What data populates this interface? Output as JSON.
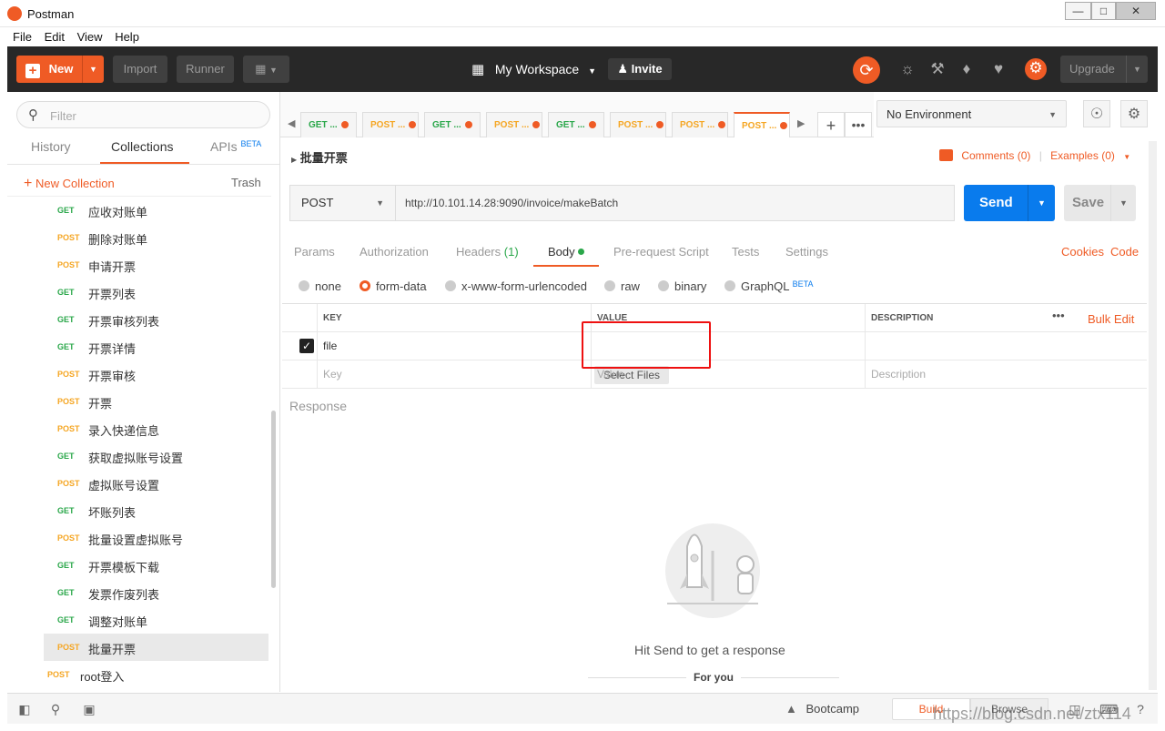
{
  "window": {
    "title": "Postman",
    "minimize": "—",
    "maximize": "□",
    "close": "✕"
  },
  "menu": [
    "File",
    "Edit",
    "View",
    "Help"
  ],
  "header": {
    "new_label": "New",
    "import_label": "Import",
    "runner_label": "Runner",
    "workspace_label": "My Workspace",
    "invite_label": "Invite",
    "upgrade_label": "Upgrade"
  },
  "sidebar": {
    "filter_placeholder": "Filter",
    "tabs": [
      "History",
      "Collections",
      "APIs"
    ],
    "apis_badge": "BETA",
    "new_collection_label": "New Collection",
    "trash_label": "Trash",
    "requests": [
      {
        "method": "GET",
        "name": "应收对账单"
      },
      {
        "method": "POST",
        "name": "删除对账单"
      },
      {
        "method": "POST",
        "name": "申请开票"
      },
      {
        "method": "GET",
        "name": "开票列表"
      },
      {
        "method": "GET",
        "name": "开票审核列表"
      },
      {
        "method": "GET",
        "name": "开票详情"
      },
      {
        "method": "POST",
        "name": "开票审核"
      },
      {
        "method": "POST",
        "name": "开票"
      },
      {
        "method": "POST",
        "name": "录入快递信息"
      },
      {
        "method": "GET",
        "name": "获取虚拟账号设置"
      },
      {
        "method": "POST",
        "name": "虚拟账号设置"
      },
      {
        "method": "GET",
        "name": "坏账列表"
      },
      {
        "method": "POST",
        "name": "批量设置虚拟账号"
      },
      {
        "method": "GET",
        "name": "开票模板下载"
      },
      {
        "method": "GET",
        "name": "发票作废列表"
      },
      {
        "method": "GET",
        "name": "调整对账单"
      },
      {
        "method": "POST",
        "name": "批量开票"
      }
    ],
    "extra_request": {
      "method": "POST",
      "name": "root登入"
    }
  },
  "tabs": [
    {
      "method": "GET",
      "label": "GET ..."
    },
    {
      "method": "POST",
      "label": "POST ..."
    },
    {
      "method": "GET",
      "label": "GET ..."
    },
    {
      "method": "POST",
      "label": "POST ..."
    },
    {
      "method": "GET",
      "label": "GET ..."
    },
    {
      "method": "POST",
      "label": "POST ..."
    },
    {
      "method": "POST",
      "label": "POST ..."
    },
    {
      "method": "POST",
      "label": "POST ..."
    }
  ],
  "environment": {
    "selected": "No Environment"
  },
  "request": {
    "name": "批量开票",
    "comments": "Comments (0)",
    "examples": "Examples (0)",
    "method": "POST",
    "url": "http://10.101.14.28:9090/invoice/makeBatch",
    "send_label": "Send",
    "save_label": "Save"
  },
  "request_tabs": {
    "items": [
      "Params",
      "Authorization",
      "Headers",
      "Body",
      "Pre-request Script",
      "Tests",
      "Settings"
    ],
    "headers_count": "(1)",
    "cookies": "Cookies",
    "code": "Code"
  },
  "body_options": [
    "none",
    "form-data",
    "x-www-form-urlencoded",
    "raw",
    "binary",
    "GraphQL"
  ],
  "graphql_badge": "BETA",
  "kv_table": {
    "headers": [
      "KEY",
      "VALUE",
      "DESCRIPTION"
    ],
    "bulk_edit": "Bulk Edit",
    "row": {
      "key": "file",
      "value_button": "Select Files"
    },
    "placeholders": {
      "key": "Key",
      "value": "Value",
      "description": "Description"
    }
  },
  "response": {
    "title": "Response",
    "hint": "Hit Send to get a response",
    "for_you": "For you"
  },
  "statusbar": {
    "bootcamp": "Bootcamp",
    "build": "Build",
    "browse": "Browse"
  },
  "watermark": "https://blog.csdn.net/ztx114",
  "colors": {
    "accent": "#ef5b25",
    "send_blue": "#097bed",
    "get_green": "#2aa74a",
    "post_orange": "#f5a623"
  }
}
